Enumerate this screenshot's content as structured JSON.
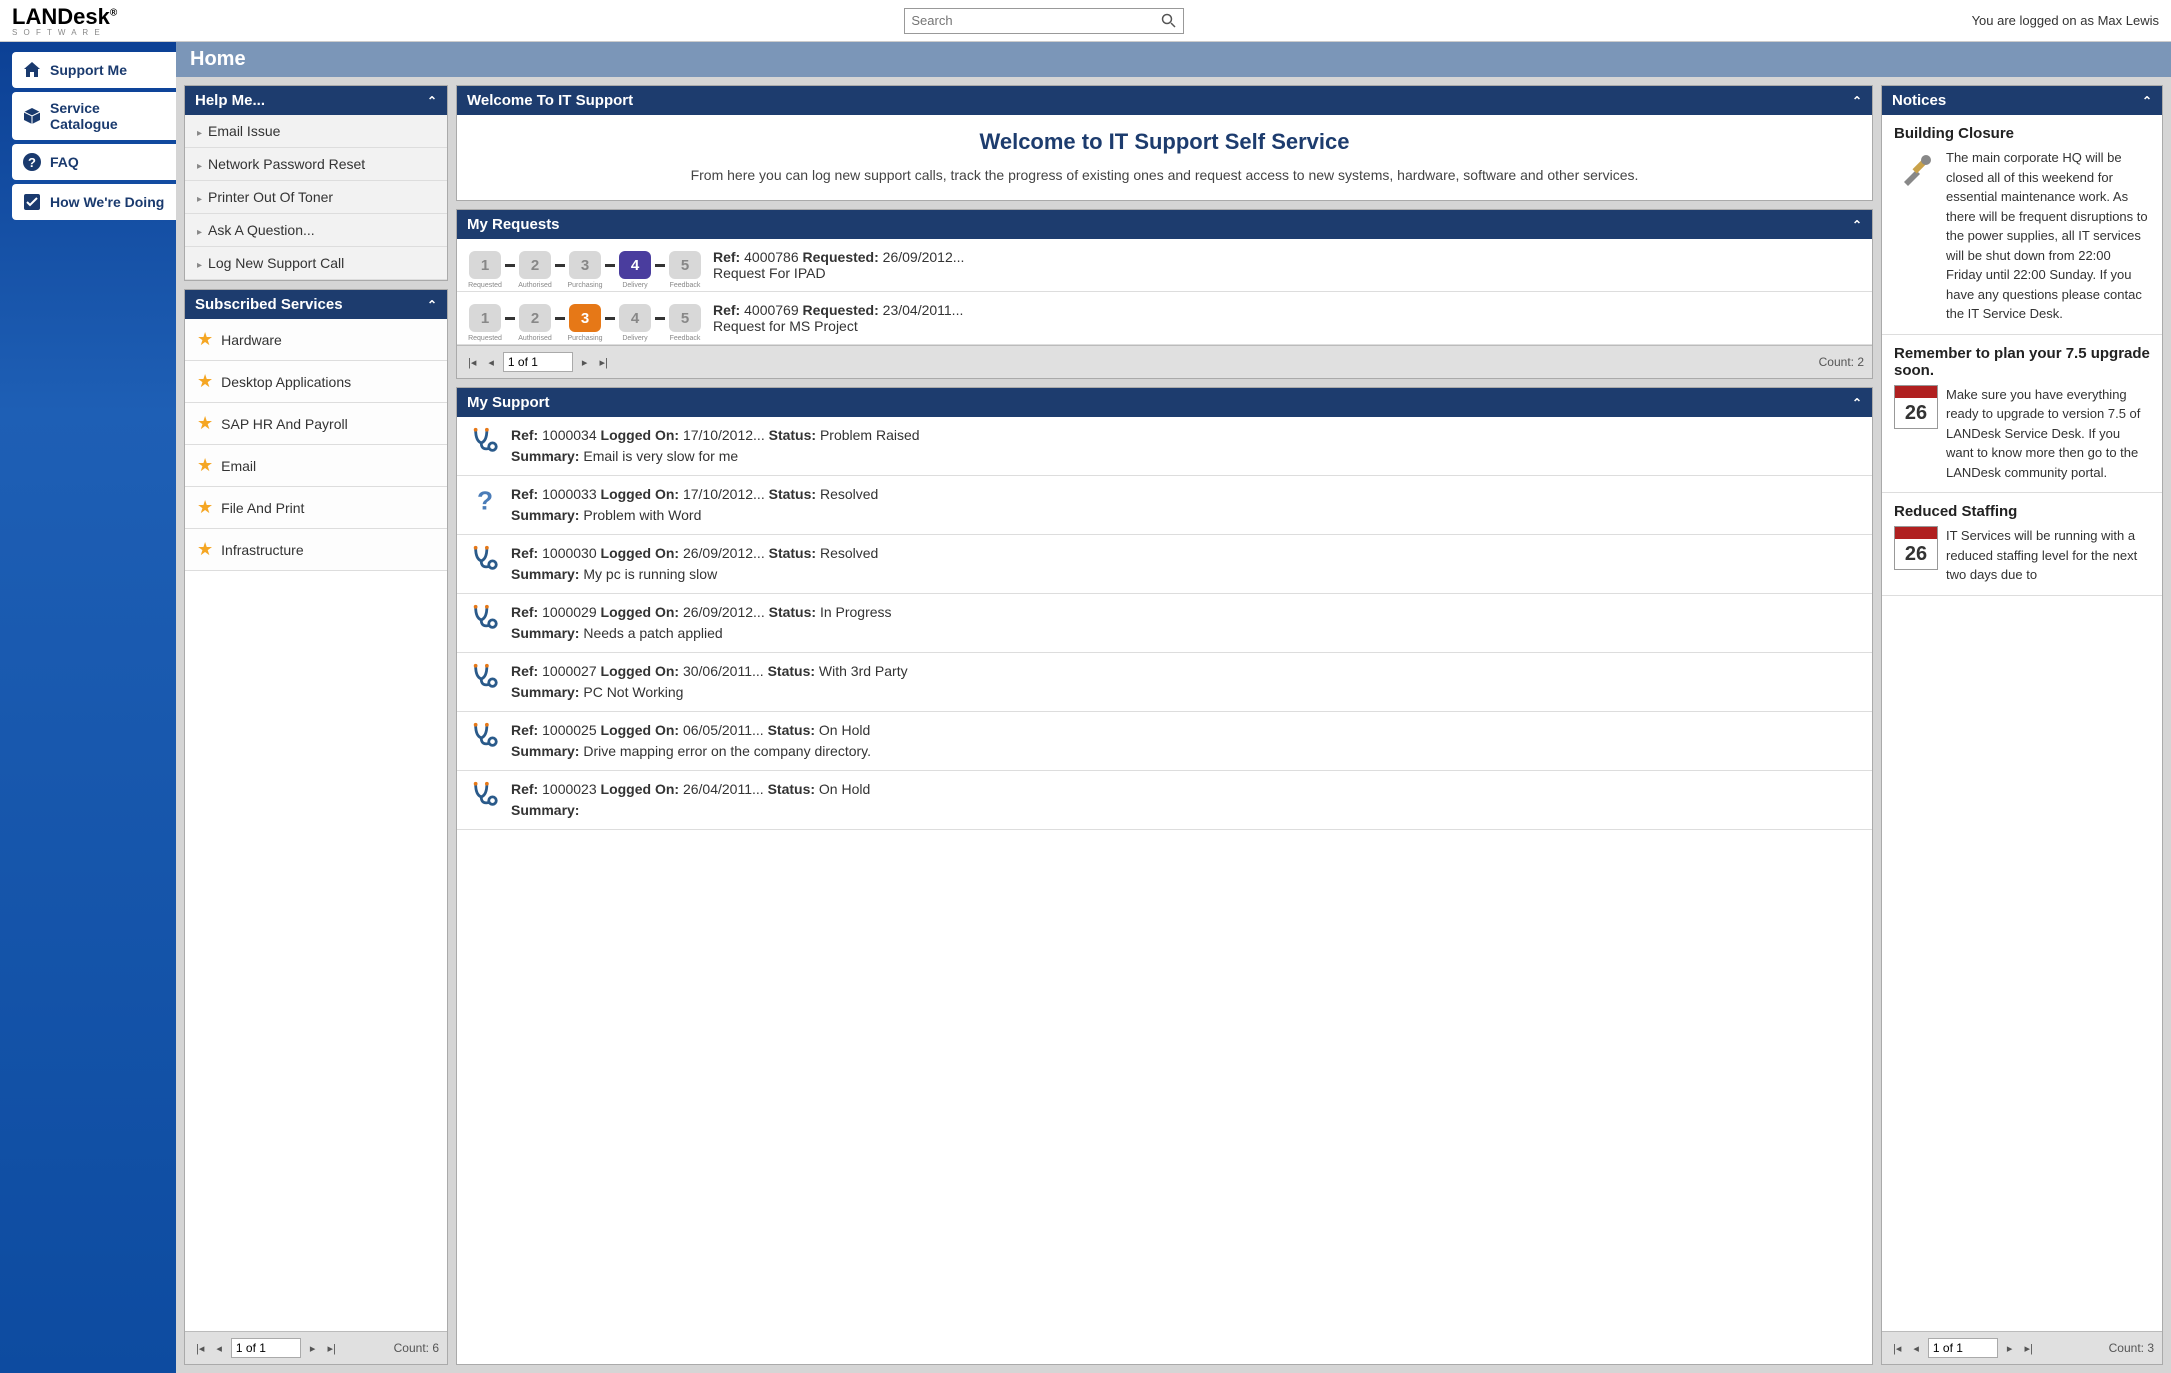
{
  "header": {
    "logo": "LANDesk",
    "logo_sub": "S O F T W A R E",
    "search_placeholder": "Search",
    "login_text": "You are logged on as Max Lewis"
  },
  "nav": [
    {
      "id": "support-me",
      "label": "Support Me",
      "icon": "home"
    },
    {
      "id": "service-catalogue",
      "label": "Service Catalogue",
      "icon": "box"
    },
    {
      "id": "faq",
      "label": "FAQ",
      "icon": "question"
    },
    {
      "id": "how-doing",
      "label": "How We're Doing",
      "icon": "check"
    }
  ],
  "page_title": "Home",
  "help_me": {
    "title": "Help Me...",
    "items": [
      "Email Issue",
      "Network Password Reset",
      "Printer Out Of Toner",
      "Ask A Question...",
      "Log New Support Call"
    ]
  },
  "subscribed": {
    "title": "Subscribed Services",
    "items": [
      "Hardware",
      "Desktop Applications",
      "SAP HR And Payroll",
      "Email",
      "File And Print",
      "Infrastructure"
    ],
    "page": "1 of 1",
    "count": "Count: 6"
  },
  "welcome": {
    "panel_title": "Welcome To IT Support",
    "heading": "Welcome to IT Support Self Service",
    "text": "From here you can log new support calls, track the progress of existing ones and request access to new systems, hardware, software and other services."
  },
  "my_requests": {
    "title": "My Requests",
    "items": [
      {
        "ref": "4000786",
        "requested": "26/09/2012...",
        "desc": "Request For IPAD",
        "active_step": 4,
        "step_labels": [
          "Requested",
          "Authorised",
          "Purchasing",
          "Delivery",
          "Feedback"
        ]
      },
      {
        "ref": "4000769",
        "requested": "23/04/2011...",
        "desc": "Request for MS Project",
        "active_step": 3,
        "step_labels": [
          "Requested",
          "Authorised",
          "Purchasing",
          "Delivery",
          "Feedback"
        ]
      }
    ],
    "page": "1 of 1",
    "count": "Count: 2",
    "ref_label": "Ref:",
    "requested_label": "Requested:"
  },
  "my_support": {
    "title": "My Support",
    "ref_label": "Ref:",
    "logged_label": "Logged On:",
    "status_label": "Status:",
    "summary_label": "Summary:",
    "items": [
      {
        "ref": "1000034",
        "logged": "17/10/2012...",
        "status": "Problem Raised",
        "summary": "Email is very slow for me",
        "icon": "steth"
      },
      {
        "ref": "1000033",
        "logged": "17/10/2012...",
        "status": "Resolved",
        "summary": "Problem with Word",
        "icon": "question"
      },
      {
        "ref": "1000030",
        "logged": "26/09/2012...",
        "status": "Resolved",
        "summary": "My pc is running slow",
        "icon": "steth"
      },
      {
        "ref": "1000029",
        "logged": "26/09/2012...",
        "status": "In Progress",
        "summary": "Needs a patch applied",
        "icon": "steth"
      },
      {
        "ref": "1000027",
        "logged": "30/06/2011...",
        "status": "With 3rd Party",
        "summary": "PC Not Working",
        "icon": "steth"
      },
      {
        "ref": "1000025",
        "logged": "06/05/2011...",
        "status": "On Hold",
        "summary": "Drive mapping error on the company directory.",
        "icon": "steth"
      },
      {
        "ref": "1000023",
        "logged": "26/04/2011...",
        "status": "On Hold",
        "summary": "",
        "icon": "steth"
      }
    ]
  },
  "notices": {
    "title": "Notices",
    "items": [
      {
        "title": "Building Closure",
        "icon": "tools",
        "text": "The main corporate HQ will be closed all of this weekend for essential maintenance work. As there will be frequent disruptions to the power supplies, all IT services will be shut down from 22:00 Friday until 22:00 Sunday. If you have any questions please contac the IT Service Desk."
      },
      {
        "title": "Remember to plan your 7.5 upgrade soon.",
        "icon": "cal26",
        "text": "Make sure you have everything ready to upgrade to version 7.5 of LANDesk Service Desk. If you want to know more then go to the LANDesk community portal."
      },
      {
        "title": "Reduced Staffing",
        "icon": "cal26",
        "text": "IT Services will be running with a reduced staffing level for the next two days due to"
      }
    ],
    "page": "1 of 1",
    "count": "Count: 3"
  }
}
